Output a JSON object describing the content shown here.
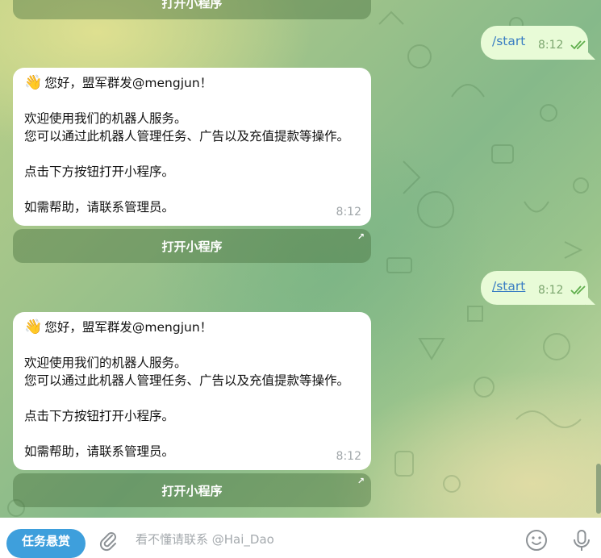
{
  "chat": {
    "bot_message": {
      "greeting_emoji": "👋",
      "greeting": "您好，盟军群发@mengjun！",
      "line2": "欢迎使用我们的机器人服务。",
      "line3": "您可以通过此机器人管理任务、广告以及充值提款等操作。",
      "line4": "点击下方按钮打开小程序。",
      "line5": "如需帮助，请联系管理员。",
      "time": "8:12"
    },
    "open_miniapp_label": "打开小程序",
    "user_command": "/start",
    "user_time": "8:12",
    "accent_link_color": "#3a7ec3",
    "outgoing_bubble_color": "#e8fbd7"
  },
  "bottom_bar": {
    "task_button_label": "任务悬赏",
    "input_placeholder": "看不懂请联系 @Hai_Dao",
    "attach_icon": "paperclip-icon",
    "emoji_icon": "smiley-icon",
    "mic_icon": "microphone-icon",
    "accent_color": "#3e9fdc"
  }
}
